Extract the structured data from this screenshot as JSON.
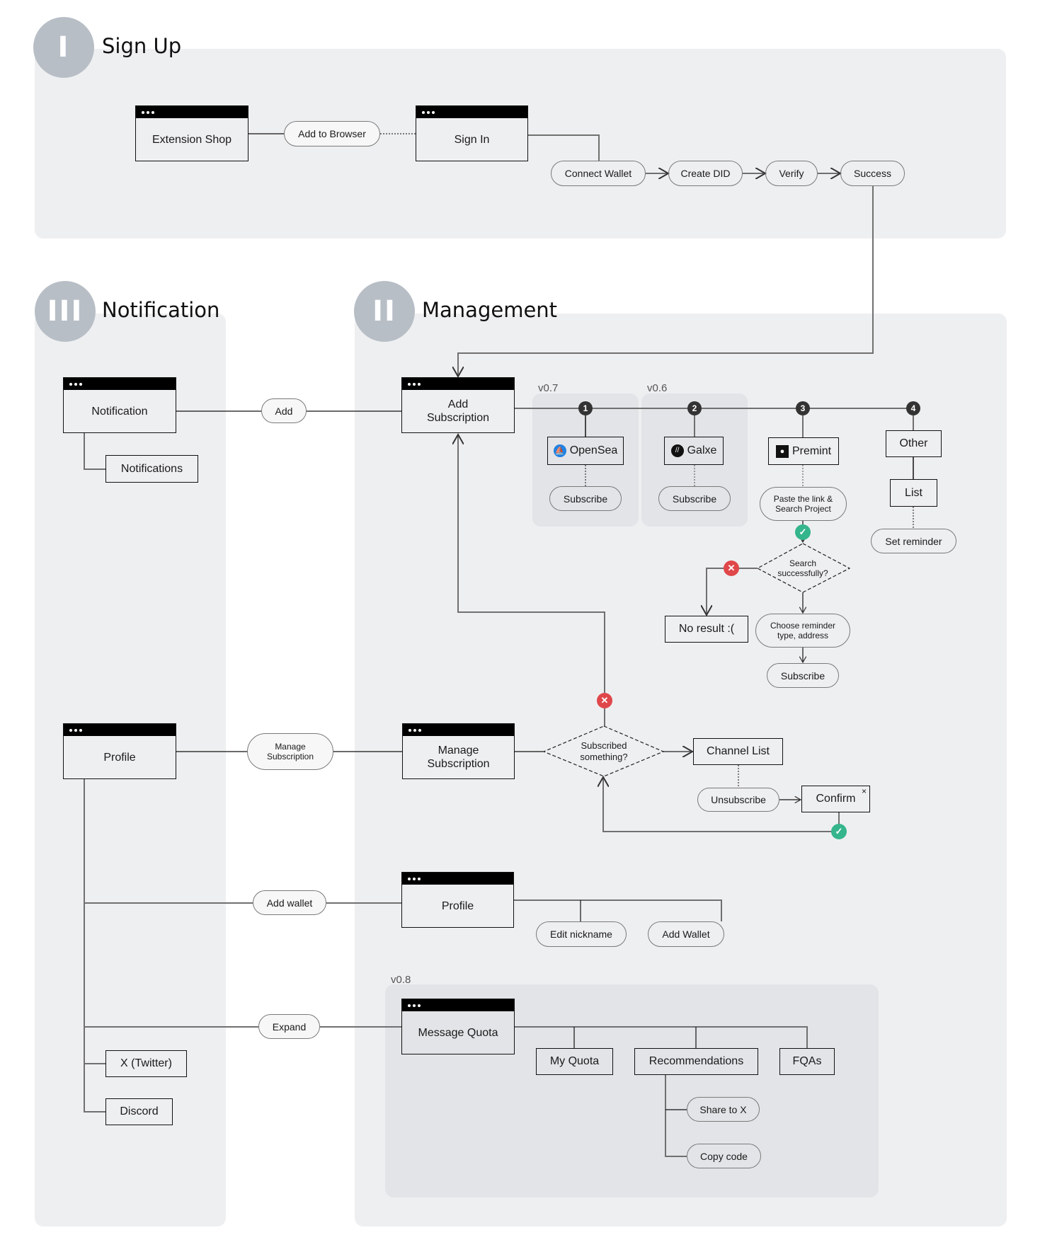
{
  "sections": {
    "signup": {
      "numeral": "I",
      "title": "Sign Up"
    },
    "management": {
      "numeral": "II",
      "title": "Management"
    },
    "notification": {
      "numeral": "III",
      "title": "Notification"
    }
  },
  "signup": {
    "extension_shop": "Extension Shop",
    "add_to_browser": "Add to Browser",
    "sign_in": "Sign In",
    "steps": [
      "Connect Wallet",
      "Create DID",
      "Verify",
      "Success"
    ]
  },
  "notification": {
    "notification_screen": "Notification",
    "notifications": "Notifications",
    "add_action": "Add",
    "profile_screen": "Profile",
    "manage_action": "Manage Subscription",
    "add_wallet_action": "Add wallet",
    "expand_action": "Expand",
    "x_twitter": "X (Twitter)",
    "discord": "Discord"
  },
  "management": {
    "add_subscription": "Add Subscription",
    "versions": {
      "v07": "v0.7",
      "v06": "v0.6",
      "v08": "v0.8"
    },
    "channels": [
      {
        "number": "1",
        "name": "OpenSea",
        "icon": "opensea-logo-icon",
        "action": "Subscribe"
      },
      {
        "number": "2",
        "name": "Galxe",
        "icon": "galxe-logo-icon",
        "action": "Subscribe"
      },
      {
        "number": "3",
        "name": "Premint",
        "icon": "premint-logo-icon",
        "action": "Paste the link & Search Project"
      },
      {
        "number": "4",
        "name": "Other",
        "list": "List",
        "action": "Set reminder"
      }
    ],
    "search_decision": "Search successfully?",
    "no_result": "No result :(",
    "choose_reminder": "Choose reminder type, address",
    "premint_subscribe": "Subscribe",
    "manage_subscription": "Manage Subscription",
    "subscribed_decision": "Subscribed something?",
    "channel_list": "Channel List",
    "unsubscribe": "Unsubscribe",
    "confirm": "Confirm",
    "profile_screen": "Profile",
    "edit_nickname": "Edit nickname",
    "add_wallet": "Add Wallet",
    "message_quota": "Message Quota",
    "my_quota": "My Quota",
    "recommendations": "Recommendations",
    "fqas": "FQAs",
    "share_to_x": "Share to X",
    "copy_code": "Copy code"
  },
  "colors": {
    "panel": "#eeeff1",
    "group": "#e2e4e7",
    "badge": "#b8bec6",
    "success": "#35b58c",
    "failure": "#e0474a",
    "opensea": "#2081e2"
  }
}
